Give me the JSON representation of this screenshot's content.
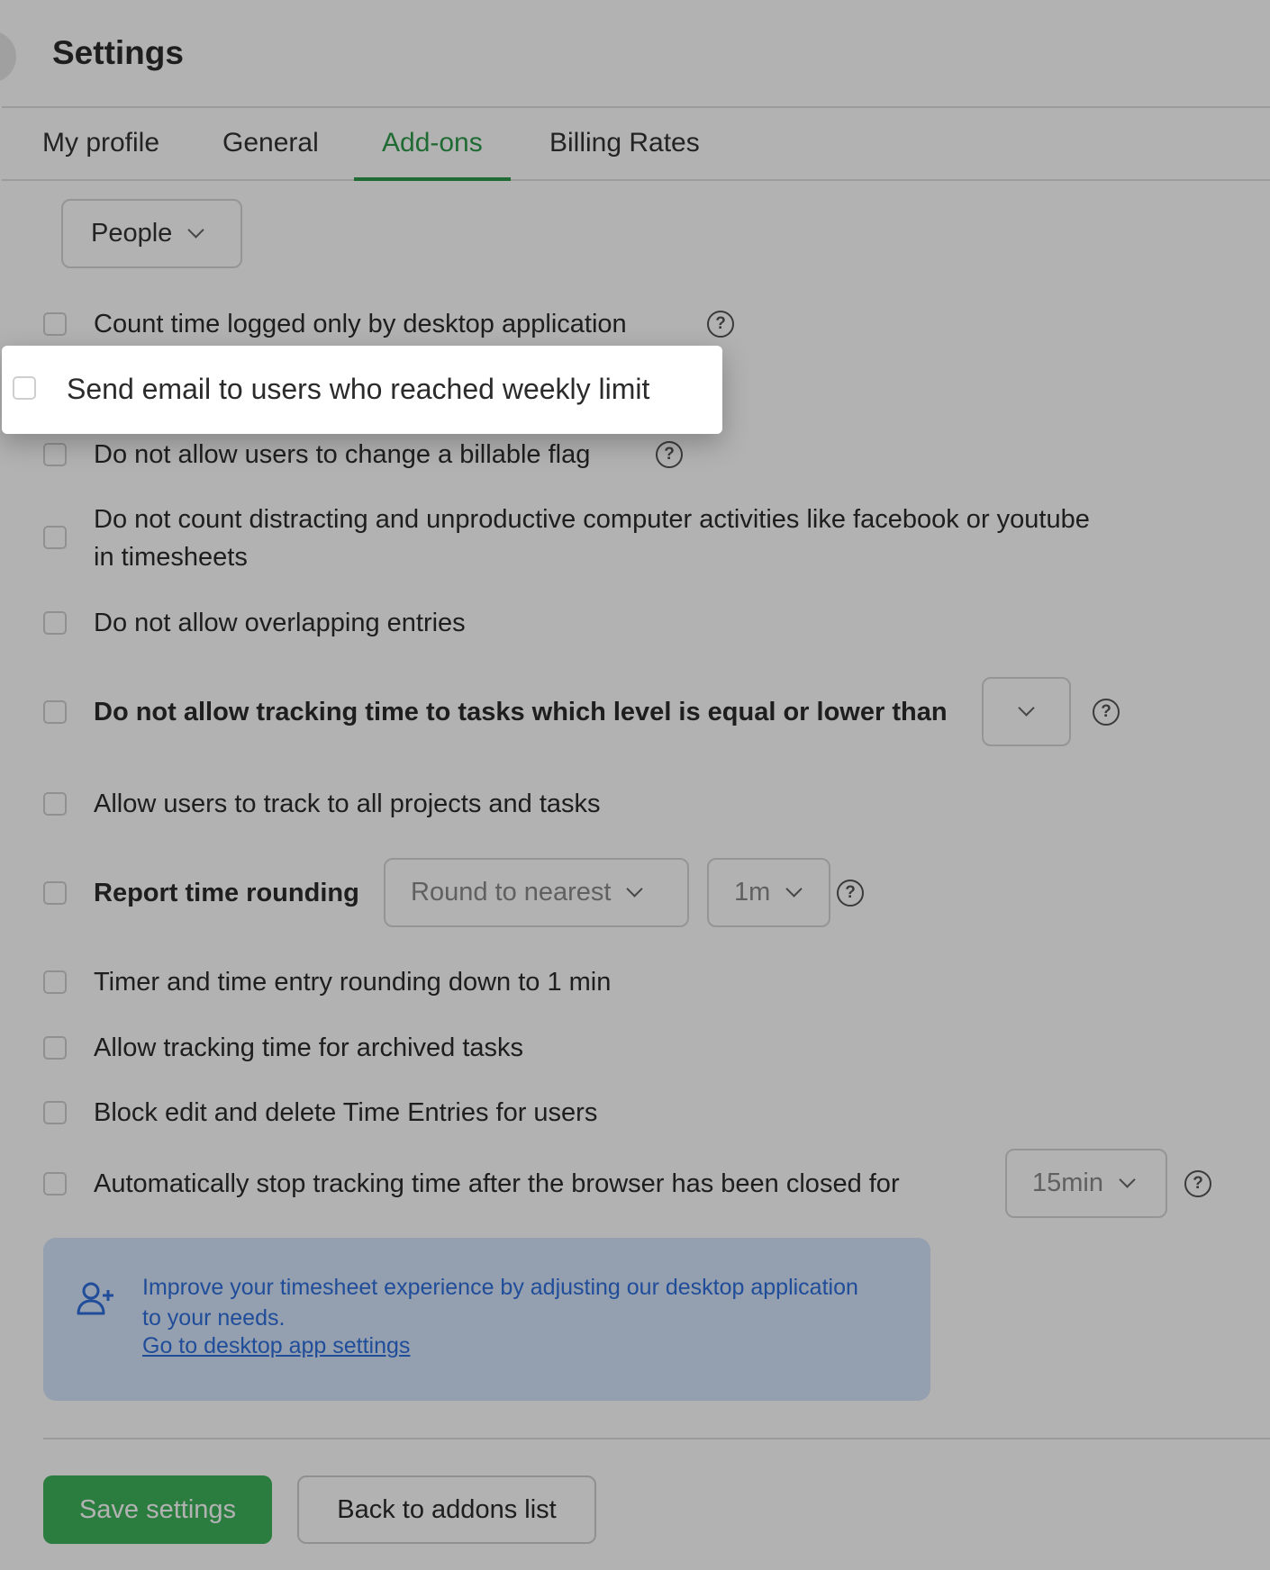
{
  "header": {
    "title": "Settings"
  },
  "tabs": [
    {
      "label": "My profile"
    },
    {
      "label": "General"
    },
    {
      "label": "Add-ons"
    },
    {
      "label": "Billing Rates"
    }
  ],
  "filter": {
    "selected": "People"
  },
  "options": [
    {
      "label": "Count time logged only by desktop application"
    },
    {
      "label": "Send email to users who reached weekly limit"
    },
    {
      "label": "Do not allow users to change a billable flag"
    },
    {
      "label_line1": "Do not count distracting and unproductive computer activities like facebook or youtube",
      "label_line2": "in timesheets"
    },
    {
      "label": "Do not allow overlapping entries"
    },
    {
      "label": "Do not allow tracking time to tasks which level is equal or lower than",
      "select_value": ""
    },
    {
      "label": "Allow users to track to all projects and tasks"
    },
    {
      "label": "Report time rounding",
      "rounding_mode": "Round to nearest",
      "rounding_unit": "1m"
    },
    {
      "label": "Timer and time entry rounding down to 1 min"
    },
    {
      "label": "Allow tracking time for archived tasks"
    },
    {
      "label": "Block edit and delete Time Entries for users"
    },
    {
      "label": "Automatically stop tracking time after the browser has been closed for",
      "select_value": "15min"
    }
  ],
  "help_glyph": "?",
  "banner": {
    "text": "Improve your timesheet experience by adjusting our desktop application to your needs.",
    "link": "Go to desktop app settings",
    "icon": "user-plus-icon",
    "color": "#2f6fdb"
  },
  "actions": {
    "save_label": "Save settings",
    "back_label": "Back to addons list"
  },
  "colors": {
    "accent": "#2f9a4b",
    "primary_button": "#3db35a"
  }
}
